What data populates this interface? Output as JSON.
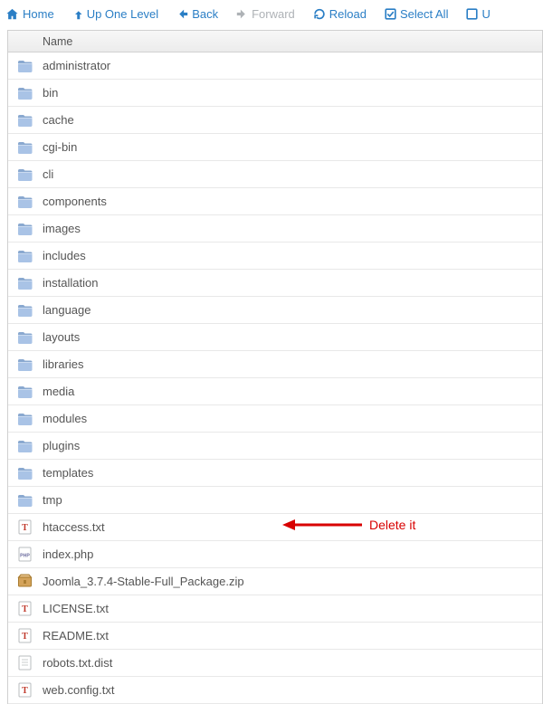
{
  "toolbar": {
    "home": "Home",
    "up": "Up One Level",
    "back": "Back",
    "forward": "Forward",
    "reload": "Reload",
    "select_all": "Select All",
    "unselect": "U"
  },
  "columns": {
    "name": "Name"
  },
  "items": [
    {
      "type": "folder",
      "name": "administrator"
    },
    {
      "type": "folder",
      "name": "bin"
    },
    {
      "type": "folder",
      "name": "cache"
    },
    {
      "type": "folder",
      "name": "cgi-bin"
    },
    {
      "type": "folder",
      "name": "cli"
    },
    {
      "type": "folder",
      "name": "components"
    },
    {
      "type": "folder",
      "name": "images"
    },
    {
      "type": "folder",
      "name": "includes"
    },
    {
      "type": "folder",
      "name": "installation"
    },
    {
      "type": "folder",
      "name": "language"
    },
    {
      "type": "folder",
      "name": "layouts"
    },
    {
      "type": "folder",
      "name": "libraries"
    },
    {
      "type": "folder",
      "name": "media"
    },
    {
      "type": "folder",
      "name": "modules"
    },
    {
      "type": "folder",
      "name": "plugins"
    },
    {
      "type": "folder",
      "name": "templates"
    },
    {
      "type": "folder",
      "name": "tmp"
    },
    {
      "type": "txt",
      "name": "htaccess.txt"
    },
    {
      "type": "php",
      "name": "index.php"
    },
    {
      "type": "zip",
      "name": "Joomla_3.7.4-Stable-Full_Package.zip"
    },
    {
      "type": "txt",
      "name": "LICENSE.txt"
    },
    {
      "type": "txt",
      "name": "README.txt"
    },
    {
      "type": "file",
      "name": "robots.txt.dist"
    },
    {
      "type": "txt",
      "name": "web.config.txt"
    }
  ],
  "annotation": {
    "text": "Delete it"
  }
}
